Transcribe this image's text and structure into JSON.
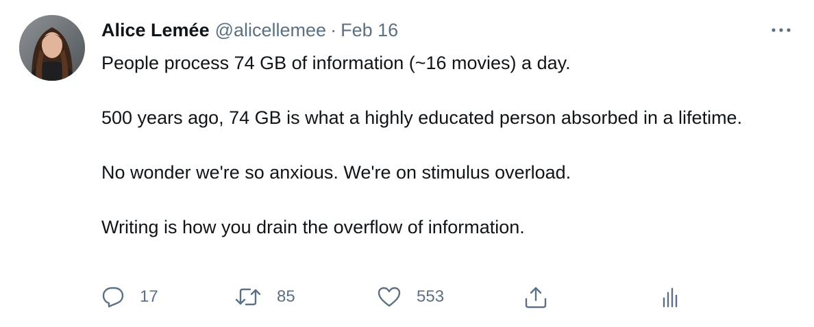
{
  "tweet": {
    "author_name": "Alice Lemée",
    "handle": "@alicellemee",
    "separator": "·",
    "date": "Feb 16",
    "paragraphs": [
      "People process 74 GB of information (~16 movies) a day.",
      "500 years ago, 74 GB is what a highly educated person absorbed in a lifetime.",
      "No wonder we're so anxious. We're on stimulus overload.",
      "Writing is how you drain the overflow of information."
    ],
    "actions": {
      "reply": {
        "icon": "reply-icon",
        "count": "17"
      },
      "retweet": {
        "icon": "retweet-icon",
        "count": "85"
      },
      "like": {
        "icon": "heart-icon",
        "count": "553"
      },
      "share": {
        "icon": "share-icon"
      },
      "analytics": {
        "icon": "analytics-icon"
      }
    }
  },
  "colors": {
    "text_primary": "#0f1419",
    "text_secondary": "#5b7083",
    "icon": "#5b7083",
    "background": "#ffffff"
  }
}
